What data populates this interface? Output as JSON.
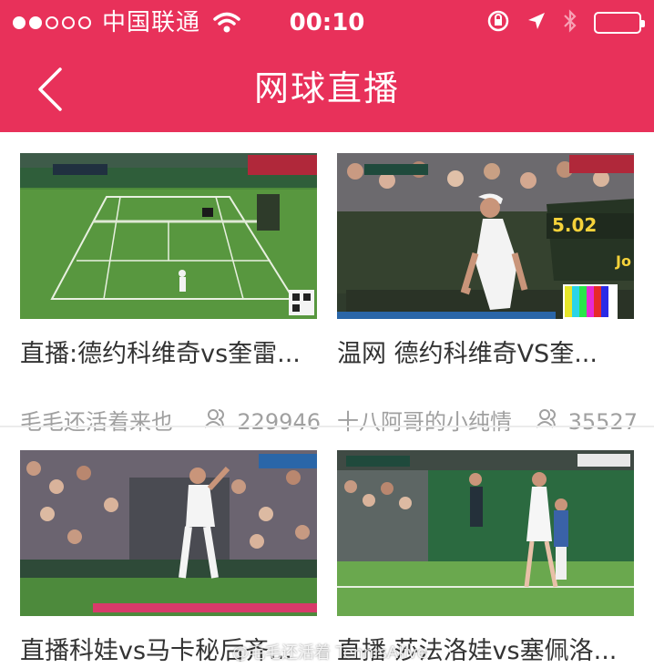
{
  "status_bar": {
    "carrier": "中国联通",
    "time": "00:10",
    "signal_dots": [
      true,
      true,
      false,
      false,
      false
    ]
  },
  "nav": {
    "title": "网球直播",
    "back_icon": "chevron-left-icon"
  },
  "colors": {
    "accent": "#e8315a",
    "court_green": "#4e8a3a",
    "meta_gray": "#a0a0a0"
  },
  "cards": [
    {
      "title": "直播:德约科维奇vs奎雷...",
      "author": "毛毛还活着来也",
      "viewers": "229946"
    },
    {
      "title": "温网 德约科维奇VS奎...",
      "author": "十八阿哥的小纯情",
      "viewers": "35527"
    },
    {
      "title": "直播科娃vs马卡秘后齐...",
      "author": "",
      "viewers": ""
    },
    {
      "title": "直播 莎法洛娃vs塞佩洛...",
      "author": "",
      "viewers": ""
    }
  ],
  "thumb_text": {
    "score_panel": "5.02",
    "score_panel_right": "Jo"
  },
  "watermark": "@毛毛还活着 TennisAlive"
}
